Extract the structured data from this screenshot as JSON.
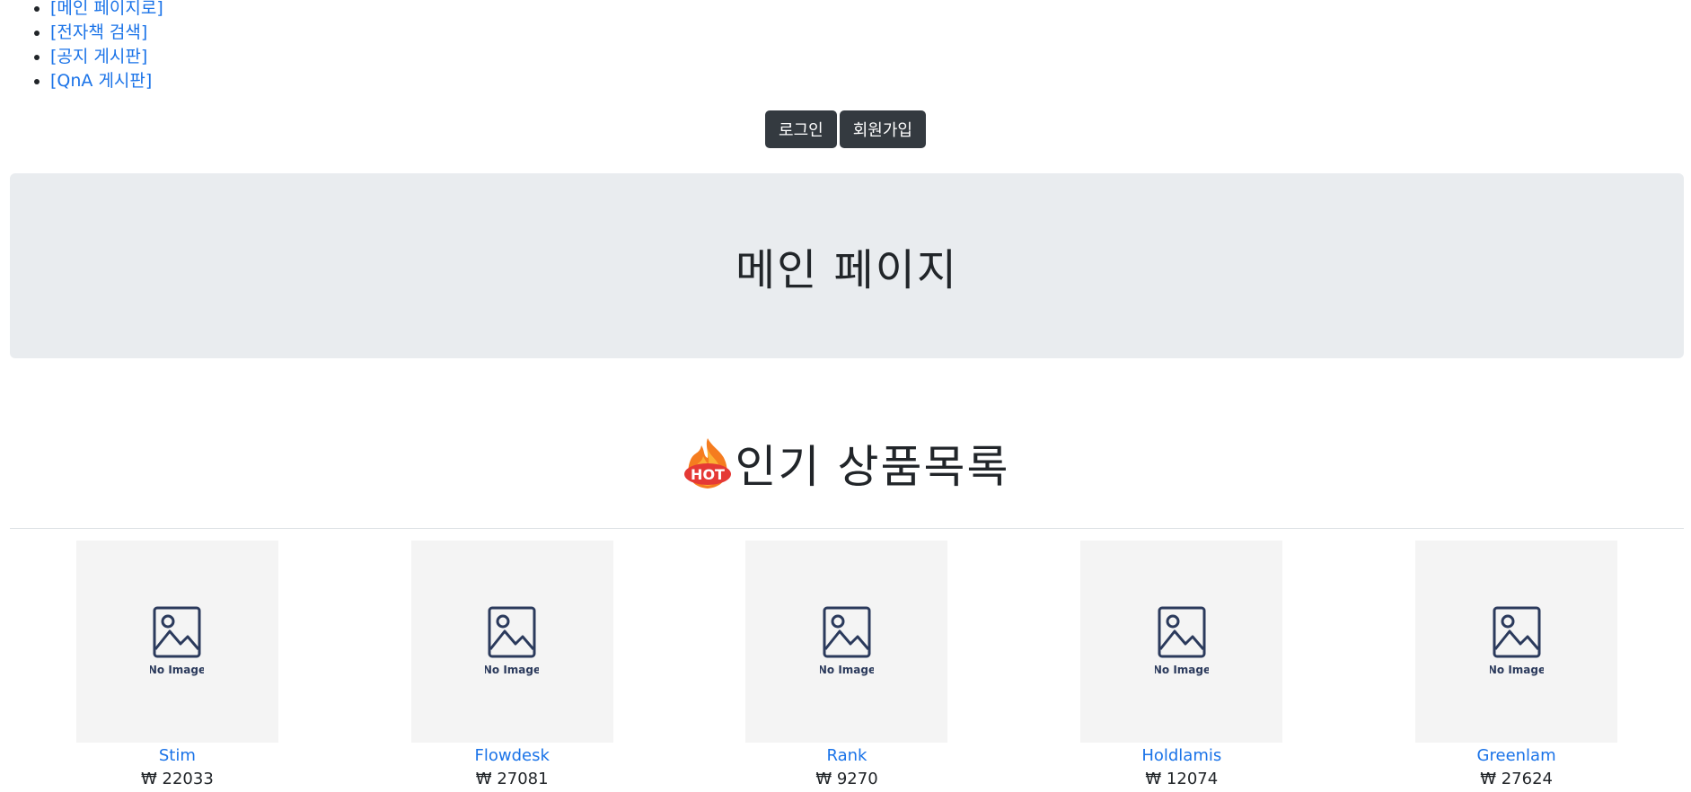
{
  "nav": {
    "items": [
      {
        "label": "[메인 페이지로]"
      },
      {
        "label": "[전자책 검색]"
      },
      {
        "label": "[공지 게시판]"
      },
      {
        "label": "[QnA 게시판]"
      }
    ]
  },
  "auth": {
    "login_label": "로그인",
    "signup_label": "회원가입"
  },
  "hero": {
    "title": "메인 페이지"
  },
  "popular": {
    "hot_badge": "HOT",
    "title": "인기 상품목록",
    "placeholder_text": "No Image",
    "products": [
      {
        "name": "Stim",
        "price": "₩ 22033"
      },
      {
        "name": "Flowdesk",
        "price": "₩ 27081"
      },
      {
        "name": "Rank",
        "price": "₩ 9270"
      },
      {
        "name": "Holdlamis",
        "price": "₩ 12074"
      },
      {
        "name": "Greenlam",
        "price": "₩ 27624"
      }
    ]
  },
  "colors": {
    "link": "#1a73e8",
    "button_dark": "#343a40",
    "jumbotron_bg": "#e9ecef",
    "thumb_bg": "#f4f4f4",
    "no_image_icon": "#2b3a5c"
  }
}
